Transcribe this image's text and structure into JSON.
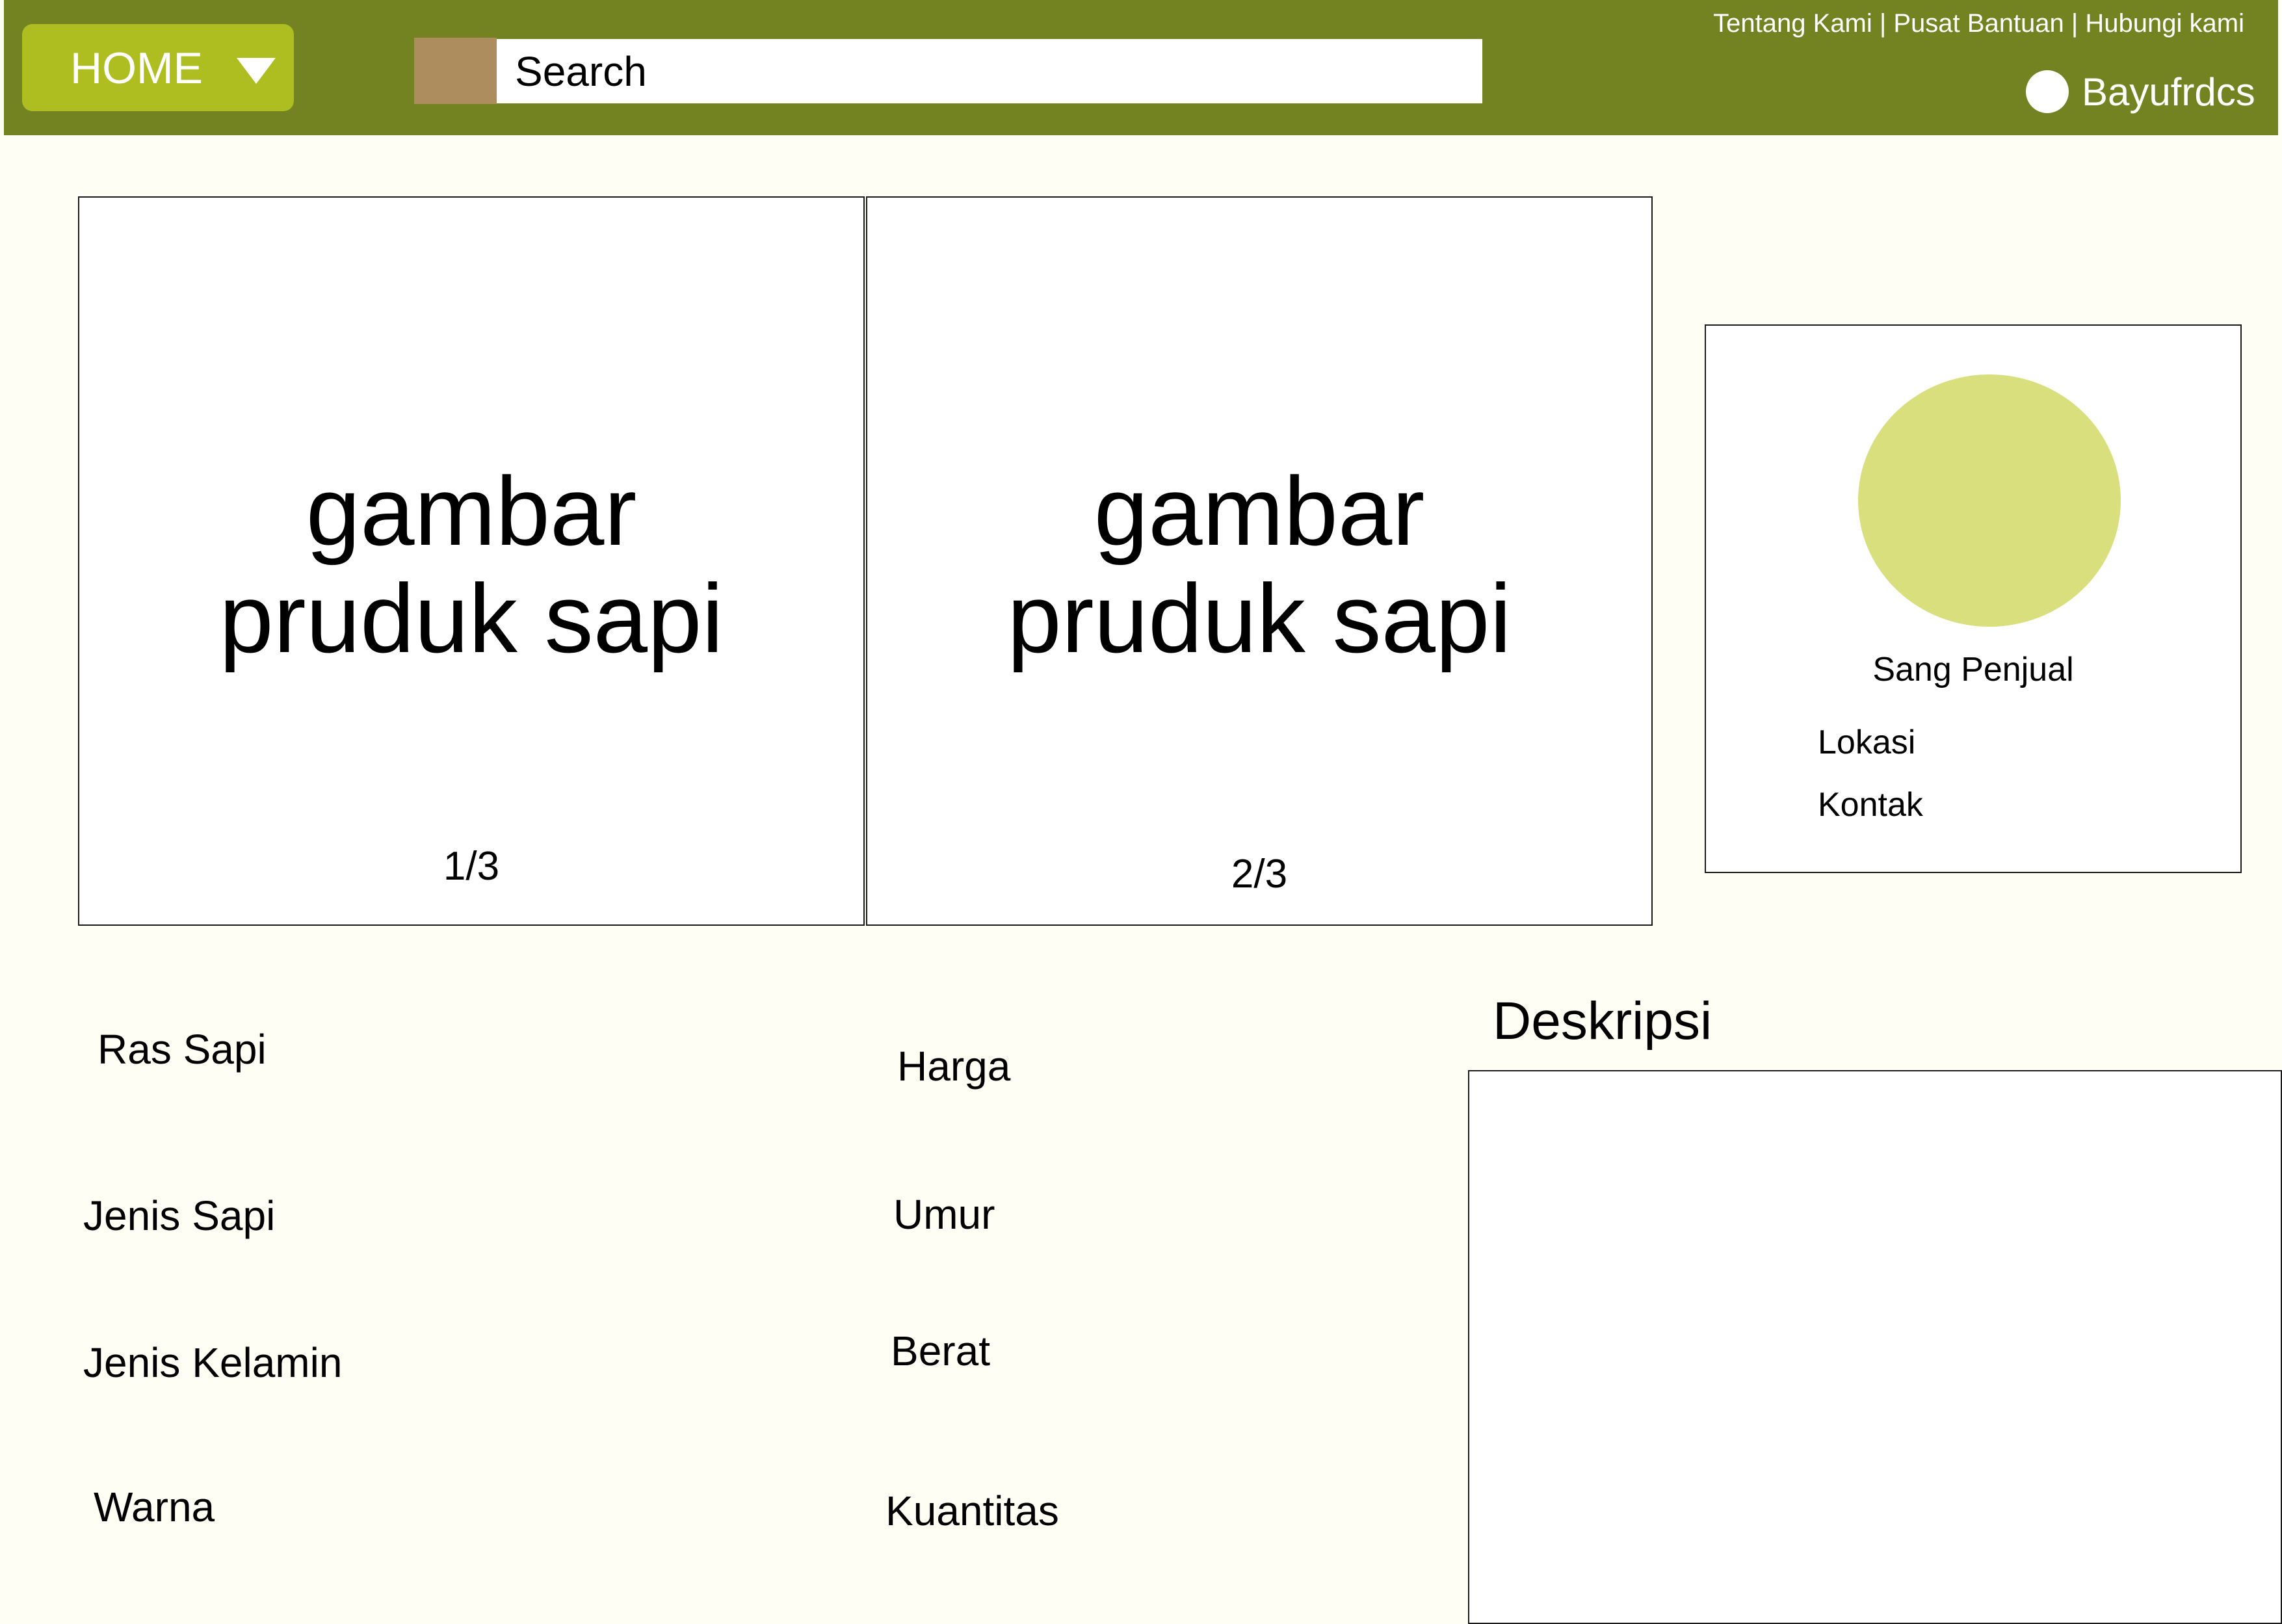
{
  "header": {
    "home_label": "HOME",
    "search": {
      "placeholder": "Search"
    },
    "links": [
      "Tentang Kami",
      "Pusat Bantuan",
      "Hubungi kami"
    ],
    "link_separator": " | ",
    "username": "Bayufrdcs"
  },
  "gallery": [
    {
      "text": "gambar\npruduk sapi",
      "counter": "1/3"
    },
    {
      "text": "gambar\npruduk sapi",
      "counter": "2/3"
    }
  ],
  "seller": {
    "name": "Sang Penjual",
    "location_label": "Lokasi",
    "contact_label": "Kontak"
  },
  "attributes": {
    "left": [
      "Ras Sapi",
      "Jenis Sapi",
      "Jenis Kelamin",
      "Warna"
    ],
    "right": [
      "Harga",
      "Umur",
      "Berat",
      "Kuantitas"
    ]
  },
  "description": {
    "title": "Deskripsi",
    "body": ""
  },
  "colors": {
    "header_bg": "#738322",
    "home_button": "#aebe21",
    "search_category": "#ad8c5e",
    "seller_avatar": "#d8df7c",
    "page_bg": "#fffef4"
  }
}
